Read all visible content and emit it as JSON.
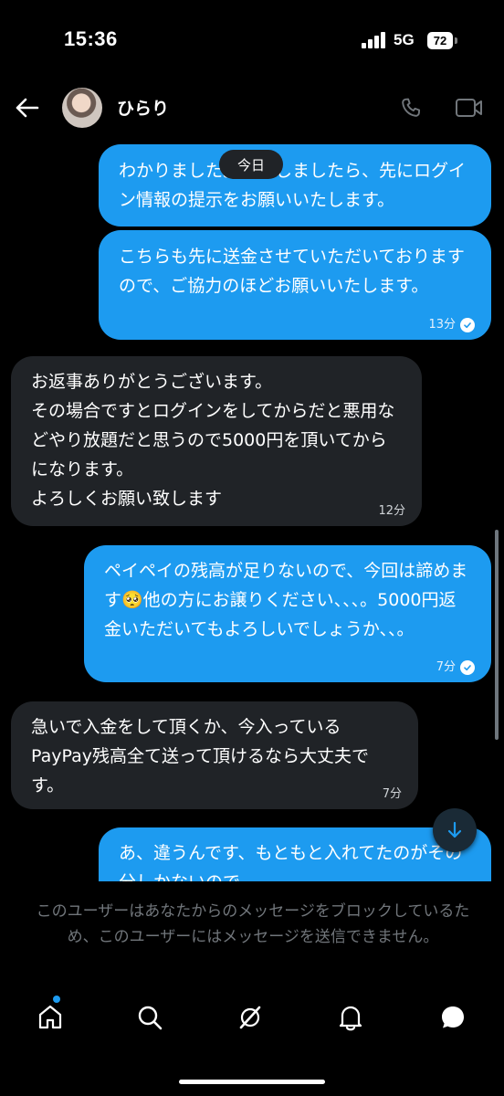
{
  "status_bar": {
    "time": "15:36",
    "network": "5G",
    "battery": "72"
  },
  "header": {
    "contact_name": "ひらり"
  },
  "chat": {
    "date_pill": "今日",
    "messages": [
      {
        "type": "sent",
        "text": "わかりました。そうしましたら、先にログイン情報の提示をお願いいたします。",
        "time": ""
      },
      {
        "type": "sent",
        "text": "こちらも先に送金させていただいておりますので、ご協力のほどお願いいたします。",
        "time": "13分"
      },
      {
        "type": "received",
        "text": "お返事ありがとうございます。\nその場合ですとログインをしてからだと悪用などやり放題だと思うので5000円を頂いてからになります。\nよろしくお願い致します",
        "time": "12分"
      },
      {
        "type": "sent",
        "text": "ペイペイの残高が足りないので、今回は諦めます🥺他の方にお譲りください、、、。5000円返金いただいてもよろしいでしょうか、、。",
        "time": "7分"
      },
      {
        "type": "received",
        "text": "急いで入金をして頂くか、今入っているPayPay残高全て送って頂けるなら大丈夫です。",
        "time": "7分"
      },
      {
        "type": "sent",
        "text": "あ、違うんです、もともと入れてたのがその分しかないので",
        "time": ""
      }
    ]
  },
  "notice": {
    "text": "このユーザーはあなたからのメッセージをブロックしているため、このユーザーにはメッセージを送信できません。"
  },
  "tabbar": {
    "items": [
      "home-icon",
      "search-icon",
      "grok-icon",
      "notifications-icon",
      "messages-icon"
    ]
  },
  "colors": {
    "accent": "#1d9bf0",
    "received_bubble": "#202327",
    "background": "#000000"
  }
}
